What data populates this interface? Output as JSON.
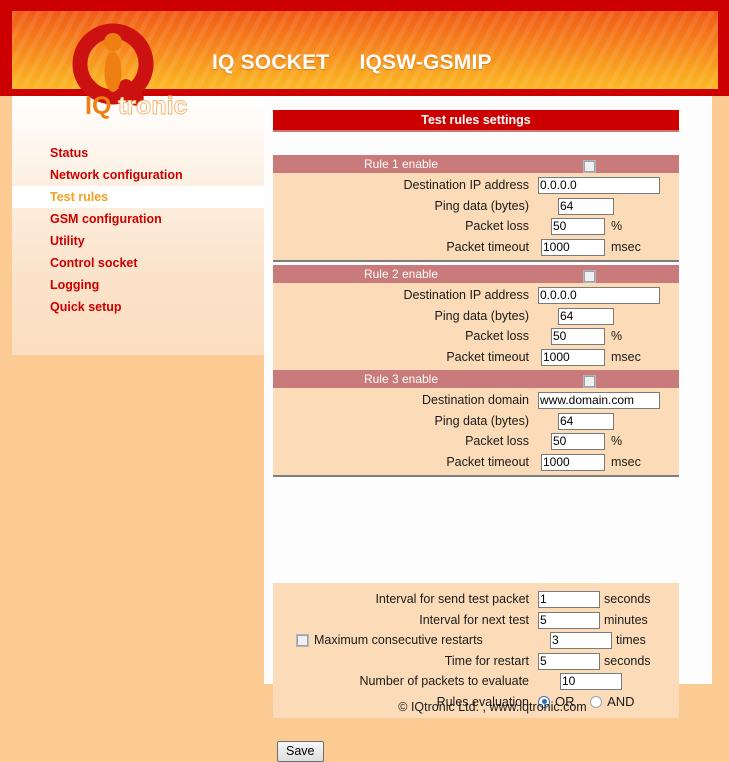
{
  "header": {
    "product": "IQ SOCKET",
    "model": "IQSW-GSMIP",
    "title_combined": "IQ SOCKET     IQSW-GSMIP",
    "logo_alt": "IQtronic",
    "logo_word_iq": "IQ",
    "logo_word_tronic": "tronic",
    "colors": {
      "frame_red": "#cc0000",
      "gradient_top": "#f05a16",
      "gradient_bottom": "#fbb825"
    }
  },
  "sidebar": {
    "items": [
      {
        "label": "Status",
        "active": false
      },
      {
        "label": "Network configuration",
        "active": false
      },
      {
        "label": "Test rules",
        "active": true
      },
      {
        "label": "GSM configuration",
        "active": false
      },
      {
        "label": "Utility",
        "active": false
      },
      {
        "label": "Control socket",
        "active": false
      },
      {
        "label": "Logging",
        "active": false
      },
      {
        "label": "Quick setup",
        "active": false
      }
    ],
    "link_color": "#cc0000",
    "active_color": "#f5a01e"
  },
  "main": {
    "panel_title": "Test rules settings",
    "rules": [
      {
        "header": "Rule 1 enable",
        "enabled": false,
        "dest_label": "Destination IP address",
        "dest_value": "0.0.0.0",
        "ping_label": "Ping data (bytes)",
        "ping_value": "64",
        "loss_label": "Packet loss",
        "loss_value": "50",
        "loss_unit": "%",
        "timeout_label": "Packet timeout",
        "timeout_value": "1000",
        "timeout_unit": "msec"
      },
      {
        "header": "Rule 2 enable",
        "enabled": false,
        "dest_label": "Destination IP address",
        "dest_value": "0.0.0.0",
        "ping_label": "Ping data (bytes)",
        "ping_value": "64",
        "loss_label": "Packet loss",
        "loss_value": "50",
        "loss_unit": "%",
        "timeout_label": "Packet timeout",
        "timeout_value": "1000",
        "timeout_unit": "msec"
      },
      {
        "header": "Rule 3 enable",
        "enabled": false,
        "dest_label": "Destination domain",
        "dest_value": "www.domain.com",
        "ping_label": "Ping data (bytes)",
        "ping_value": "64",
        "loss_label": "Packet loss",
        "loss_value": "50",
        "loss_unit": "%",
        "timeout_label": "Packet timeout",
        "timeout_value": "1000",
        "timeout_unit": "msec"
      }
    ],
    "settings": {
      "interval_send_label": "Interval for send test packet",
      "interval_send_value": "1",
      "interval_send_unit": "seconds",
      "interval_next_label": "Interval for next test",
      "interval_next_value": "5",
      "interval_next_unit": "minutes",
      "max_restarts_label": "Maximum consecutive restarts",
      "max_restarts_checked": false,
      "max_restarts_value": "3",
      "max_restarts_unit": "times",
      "time_restart_label": "Time for restart",
      "time_restart_value": "5",
      "time_restart_unit": "seconds",
      "packets_label": "Number of packets to evaluate",
      "packets_value": "10",
      "rules_eval_label": "Rules evaluation",
      "rules_eval_or": "OR",
      "rules_eval_and": "AND",
      "rules_eval_selected": "OR"
    },
    "save_label": "Save"
  },
  "footer": {
    "text": "© IQtronic Ltd. , www.iqtronic.com"
  }
}
